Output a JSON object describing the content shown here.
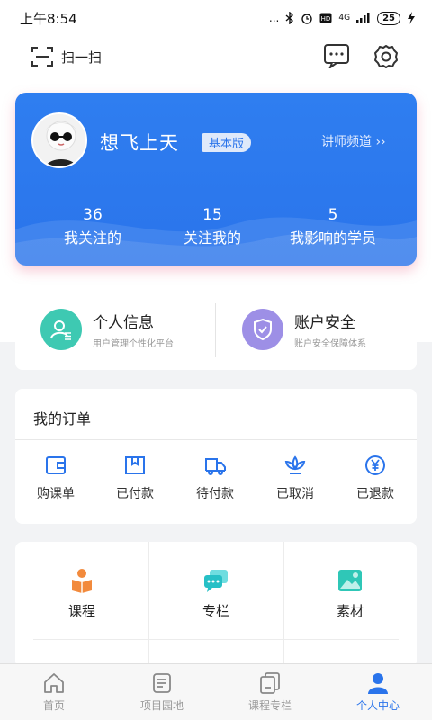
{
  "status_bar": {
    "time": "上午8:54",
    "signal": "...",
    "network": "4G",
    "battery": "25"
  },
  "header": {
    "scan_label": "扫一扫"
  },
  "profile": {
    "username": "想飞上天",
    "badge": "基本版",
    "lecturer_link": "讲师频道 ››",
    "stats": [
      {
        "value": "36",
        "label": "我关注的"
      },
      {
        "value": "15",
        "label": "关注我的"
      },
      {
        "value": "5",
        "label": "我影响的学员"
      }
    ]
  },
  "info_cards": [
    {
      "title": "个人信息",
      "subtitle": "用户管理个性化平台",
      "icon": "user-icon",
      "color": "#3ec9b2"
    },
    {
      "title": "账户安全",
      "subtitle": "账户安全保障体系",
      "icon": "shield-icon",
      "color": "#9d8fe6"
    }
  ],
  "orders": {
    "title": "我的订单",
    "items": [
      {
        "label": "购课单",
        "icon": "wallet-icon"
      },
      {
        "label": "已付款",
        "icon": "box-icon"
      },
      {
        "label": "待付款",
        "icon": "truck-icon"
      },
      {
        "label": "已取消",
        "icon": "lotus-icon"
      },
      {
        "label": "已退款",
        "icon": "yen-icon"
      }
    ]
  },
  "features": [
    {
      "label": "课程",
      "icon": "course-icon",
      "color": "#f28a3c"
    },
    {
      "label": "专栏",
      "icon": "chat-bubbles-icon",
      "color": "#27c0c6"
    },
    {
      "label": "素材",
      "icon": "image-icon",
      "color": "#2fc7b7"
    }
  ],
  "tabbar": {
    "items": [
      {
        "label": "首页",
        "icon": "home-icon"
      },
      {
        "label": "项目园地",
        "icon": "document-icon"
      },
      {
        "label": "课程专栏",
        "icon": "stack-icon"
      },
      {
        "label": "个人中心",
        "icon": "person-icon"
      }
    ],
    "active_index": 3,
    "active_color": "#2a74eb"
  },
  "colors": {
    "accent": "#2a74eb",
    "card_blue": "#2f7ef0"
  }
}
